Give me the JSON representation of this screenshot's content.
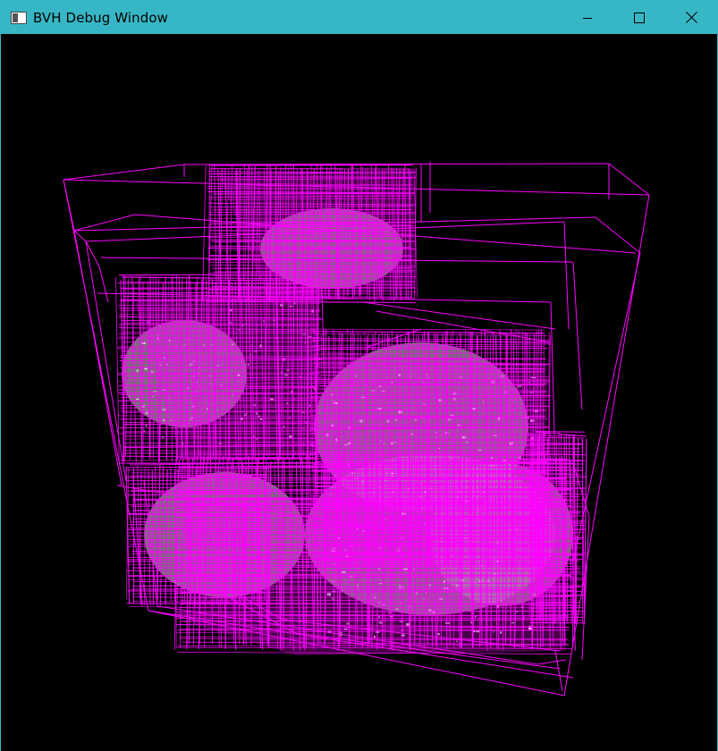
{
  "window": {
    "title": "BVH Debug Window",
    "titlebar_color": "#37b7c5"
  },
  "controls": {
    "minimize_icon": "minimize-icon",
    "maximize_icon": "maximize-icon",
    "close_icon": "close-icon"
  },
  "viewport": {
    "background": "#000000",
    "box_color": "#ff00ff",
    "mesh_color": "#9a9a9a",
    "highlight_color": "#ffffff"
  }
}
